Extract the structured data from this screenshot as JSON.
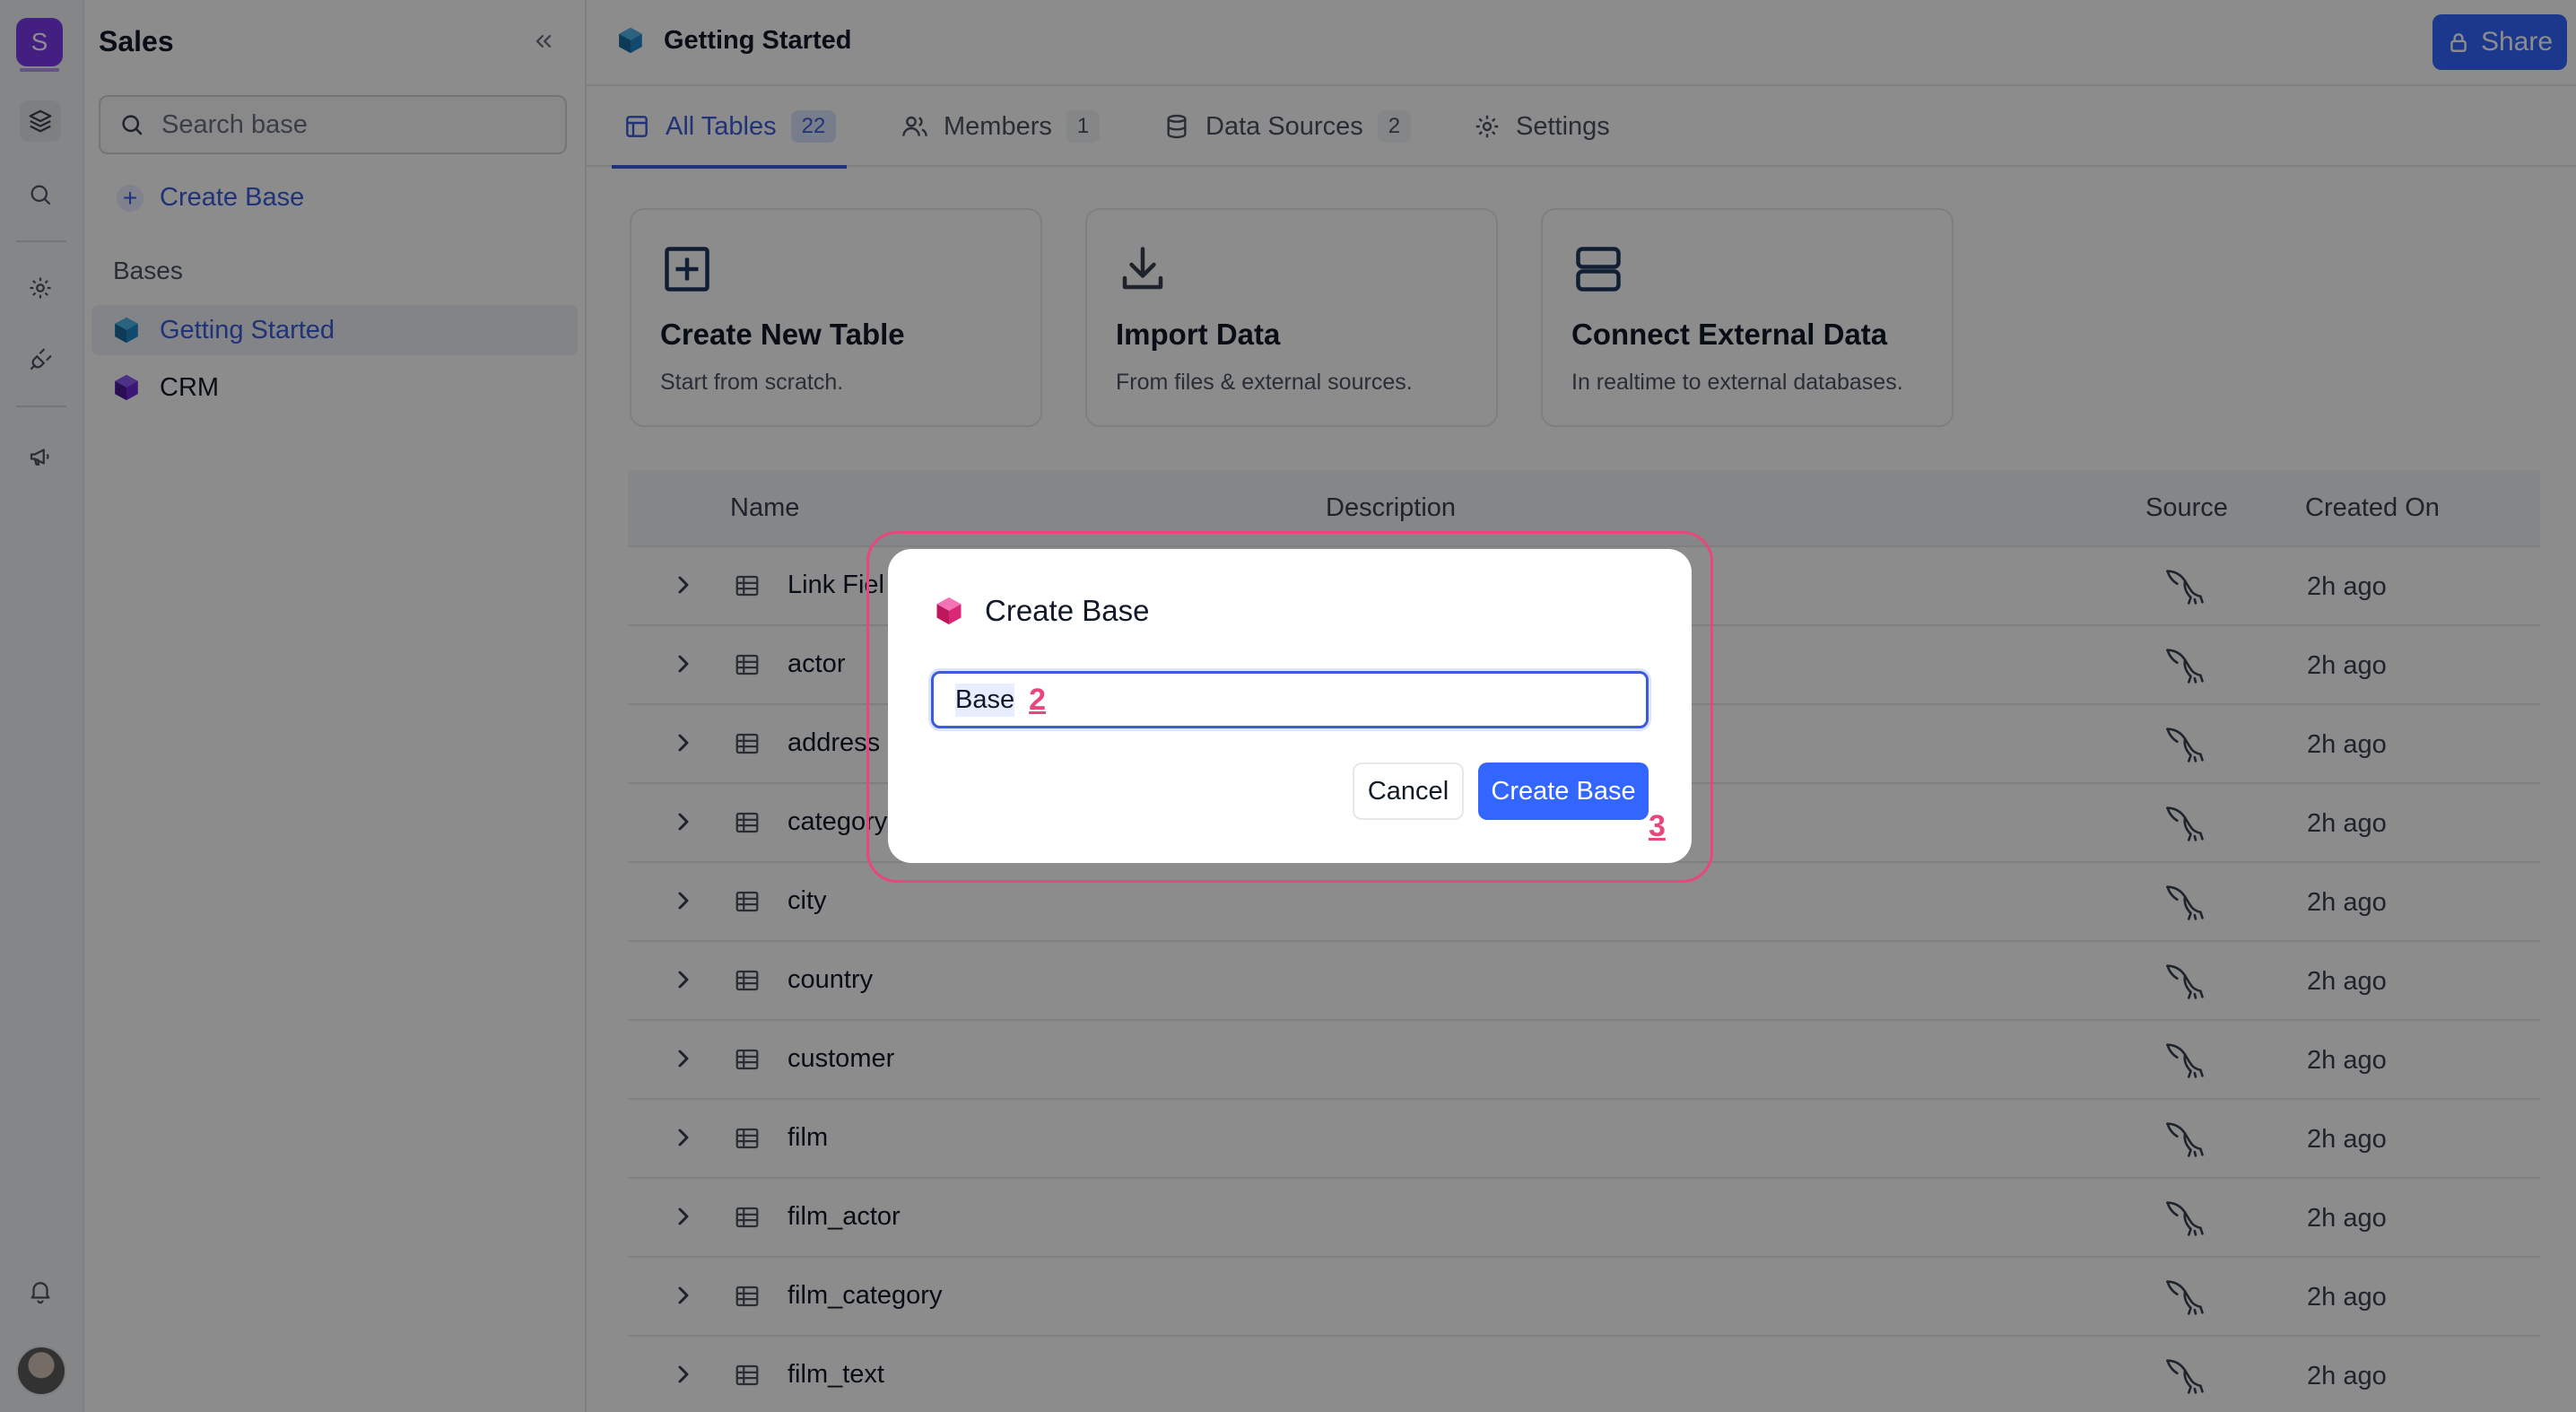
{
  "rail": {
    "workspace_initial": "S",
    "icons": [
      "layers-icon",
      "search-icon",
      "gear-icon",
      "plug-icon",
      "megaphone-icon",
      "bell-icon"
    ]
  },
  "sidebar": {
    "title": "Sales",
    "search_placeholder": "Search base",
    "create_label": "Create Base",
    "section_label": "Bases",
    "bases": [
      {
        "label": "Getting Started",
        "color": "#1e88c8",
        "active": true
      },
      {
        "label": "CRM",
        "color": "#6d28d9",
        "active": false
      }
    ]
  },
  "header": {
    "breadcrumb": "Getting Started",
    "share_label": "Share"
  },
  "tabs": [
    {
      "label": "All Tables",
      "count": "22"
    },
    {
      "label": "Members",
      "count": "1"
    },
    {
      "label": "Data Sources",
      "count": "2"
    },
    {
      "label": "Settings",
      "count": ""
    }
  ],
  "cards": [
    {
      "title": "Create New Table",
      "subtitle": "Start from scratch."
    },
    {
      "title": "Import Data",
      "subtitle": "From files & external sources."
    },
    {
      "title": "Connect External Data",
      "subtitle": "In realtime to external databases."
    }
  ],
  "table": {
    "columns": {
      "name": "Name",
      "description": "Description",
      "source": "Source",
      "created": "Created On"
    },
    "rows": [
      {
        "name": "Link Fiel",
        "created": "2h ago"
      },
      {
        "name": "actor",
        "created": "2h ago"
      },
      {
        "name": "address",
        "created": "2h ago"
      },
      {
        "name": "category",
        "created": "2h ago"
      },
      {
        "name": "city",
        "created": "2h ago"
      },
      {
        "name": "country",
        "created": "2h ago"
      },
      {
        "name": "customer",
        "created": "2h ago"
      },
      {
        "name": "film",
        "created": "2h ago"
      },
      {
        "name": "film_actor",
        "created": "2h ago"
      },
      {
        "name": "film_category",
        "created": "2h ago"
      },
      {
        "name": "film_text",
        "created": "2h ago"
      }
    ]
  },
  "modal": {
    "title": "Create Base",
    "input_value": "Base",
    "marker_input": "2",
    "cancel_label": "Cancel",
    "submit_label": "Create Base",
    "marker_submit": "3"
  },
  "colors": {
    "accent": "#3366ff",
    "tab_active": "#3b5bdb",
    "workspace": "#7c3aed",
    "highlight": "#e8467c"
  }
}
